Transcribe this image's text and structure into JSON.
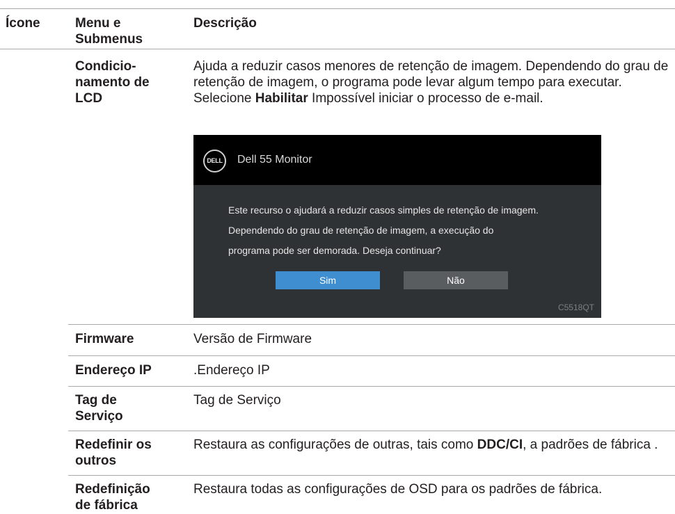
{
  "header": {
    "col_icon": "Ícone",
    "col_menu_line1": "Menu e",
    "col_menu_line2": "Submenus",
    "col_desc": "Descrição"
  },
  "rows": {
    "lcd": {
      "menu": [
        "Condicio-",
        "namento de",
        "LCD"
      ],
      "desc_before": "Ajuda a reduzir casos menores de retenção de imagem. Dependendo do grau de retenção de imagem, o programa pode levar algum tempo para executar. Selecione ",
      "desc_bold": "Habilitar",
      "desc_after": " Impossível iniciar o processo de e-mail."
    },
    "firmware": {
      "menu": "Firmware",
      "desc": "Versão de Firmware"
    },
    "ip": {
      "menu": "Endereço IP",
      "desc": ".Endereço IP"
    },
    "tag": {
      "menu": [
        "Tag de",
        "Serviço"
      ],
      "desc": "Tag de Serviço"
    },
    "reset_others": {
      "menu": [
        "Redefinir os",
        "outros"
      ],
      "desc_before": "Restaura as configurações de outras, tais como ",
      "desc_bold": "DDC/CI",
      "desc_after": ", a padrões de fábrica ."
    },
    "factory_reset": {
      "menu": [
        "Redefinição",
        "de fábrica"
      ],
      "desc": "Restaura todas as configurações de OSD para os padrões de fábrica."
    }
  },
  "osd": {
    "logo": "DELL",
    "title": "Dell 55 Monitor",
    "message": [
      "Este recurso o ajudará a reduzir casos simples de retenção de imagem.",
      "Dependendo do grau de retenção de imagem, a execução do",
      "programa pode ser demorada. Deseja continuar?"
    ],
    "yes_label": "Sim",
    "no_label": "Não",
    "model": "C5518QT"
  },
  "colors": {
    "rule": "#a7a9ac",
    "osd_bg": "#2f3234",
    "osd_header": "#000000",
    "yes_button": "#3e8ed0",
    "no_button": "#5a5d60"
  }
}
